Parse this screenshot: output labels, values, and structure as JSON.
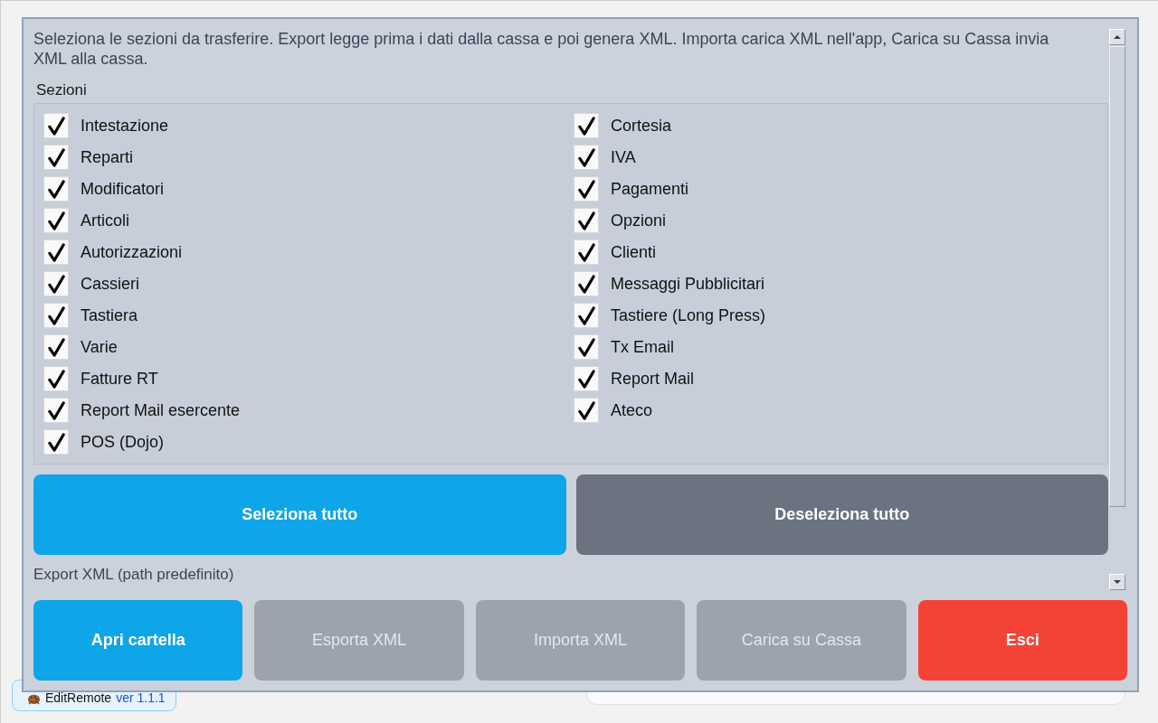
{
  "dialog": {
    "description": "Seleziona le sezioni da trasferire. Export legge prima i dati dalla cassa e poi genera XML. Importa carica XML nell'app, Carica su Cassa invia XML alla cassa.",
    "sections_label": "Sezioni",
    "sections": [
      {
        "label": "Intestazione",
        "checked": true
      },
      {
        "label": "Reparti",
        "checked": true
      },
      {
        "label": "Modificatori",
        "checked": true
      },
      {
        "label": "Articoli",
        "checked": true
      },
      {
        "label": "Autorizzazioni",
        "checked": true
      },
      {
        "label": "Cassieri",
        "checked": true
      },
      {
        "label": "Tastiera",
        "checked": true
      },
      {
        "label": "Varie",
        "checked": true
      },
      {
        "label": "Fatture RT",
        "checked": true
      },
      {
        "label": "Report Mail esercente",
        "checked": true
      },
      {
        "label": "POS (Dojo)",
        "checked": true
      },
      {
        "label": "Cortesia",
        "checked": true
      },
      {
        "label": "IVA",
        "checked": true
      },
      {
        "label": "Pagamenti",
        "checked": true
      },
      {
        "label": "Opzioni",
        "checked": true
      },
      {
        "label": "Clienti",
        "checked": true
      },
      {
        "label": "Messaggi Pubblicitari",
        "checked": true
      },
      {
        "label": "Tastiere (Long Press)",
        "checked": true
      },
      {
        "label": "Tx Email",
        "checked": true
      },
      {
        "label": "Report Mail",
        "checked": true
      },
      {
        "label": "Ateco",
        "checked": true
      }
    ],
    "selection_buttons": [
      {
        "label": "Seleziona tutto",
        "kind": "primary"
      },
      {
        "label": "Deseleziona tutto",
        "kind": "secondary"
      }
    ],
    "export_label": "Export XML (path predefinito)",
    "actions": [
      {
        "label": "Apri cartella",
        "kind": "primary",
        "disabled": false
      },
      {
        "label": "Esporta XML",
        "kind": "neutral",
        "disabled": true
      },
      {
        "label": "Importa XML",
        "kind": "neutral",
        "disabled": true
      },
      {
        "label": "Carica su Cassa",
        "kind": "neutral",
        "disabled": true
      },
      {
        "label": "Esci",
        "kind": "danger",
        "disabled": false
      }
    ]
  },
  "badge": {
    "app_name": "EditRemote",
    "version": "ver 1.1.1"
  }
}
